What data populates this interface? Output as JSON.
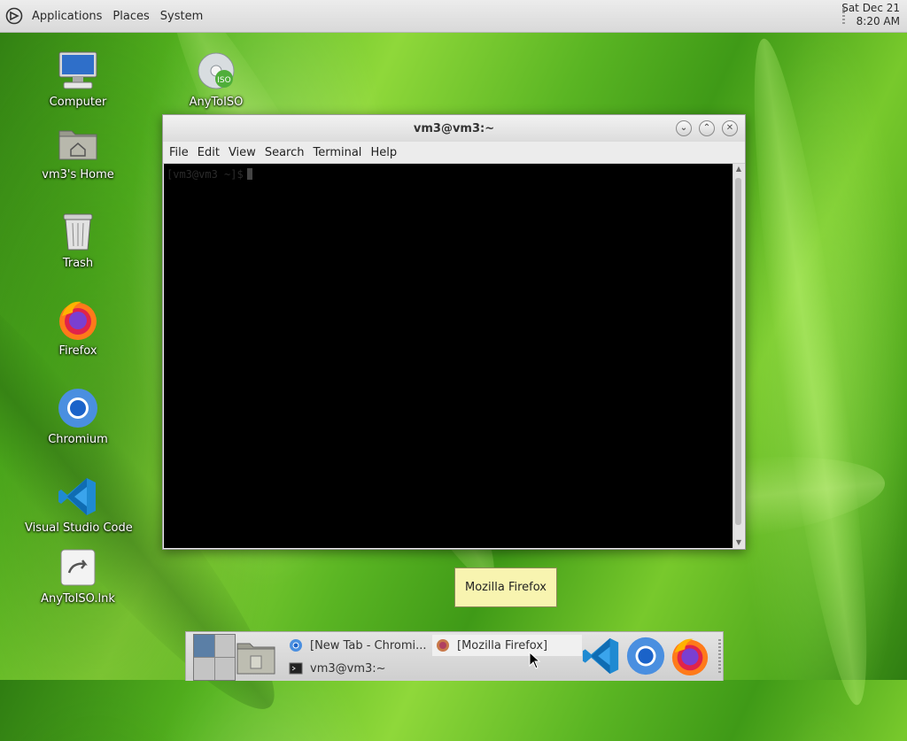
{
  "top_panel": {
    "menus": [
      "Applications",
      "Places",
      "System"
    ],
    "clock_date": "Sat Dec 21",
    "clock_time": "8:20 AM"
  },
  "desktop_icons": [
    {
      "label": "Computer",
      "icon": "computer-icon"
    },
    {
      "label": "vm3's Home",
      "icon": "home-folder-icon"
    },
    {
      "label": "Trash",
      "icon": "trash-icon"
    },
    {
      "label": "Firefox",
      "icon": "firefox-icon"
    },
    {
      "label": "Chromium",
      "icon": "chromium-icon"
    },
    {
      "label": "Visual Studio Code",
      "icon": "vscode-icon"
    },
    {
      "label": "AnyToISO.lnk",
      "icon": "link-icon"
    },
    {
      "label": "AnyToISO",
      "icon": "iso-disc-icon"
    }
  ],
  "terminal": {
    "title": "vm3@vm3:~",
    "menus": [
      "File",
      "Edit",
      "View",
      "Search",
      "Terminal",
      "Help"
    ],
    "prompt": "[vm3@vm3 ~]$"
  },
  "tooltip": "Mozilla Firefox",
  "bottom_panel": {
    "tasks": [
      {
        "label": "[New Tab - Chromi...",
        "icon": "chromium-icon"
      },
      {
        "label": "[Mozilla Firefox]",
        "icon": "firefox-icon"
      },
      {
        "label": "vm3@vm3:~",
        "icon": "terminal-icon"
      }
    ],
    "launchers": [
      "vscode-icon",
      "chromium-icon",
      "firefox-icon"
    ]
  },
  "colors": {
    "desktop_green": "#5ab523",
    "panel": "#dcdcdc",
    "tooltip": "#f8f4b0"
  }
}
